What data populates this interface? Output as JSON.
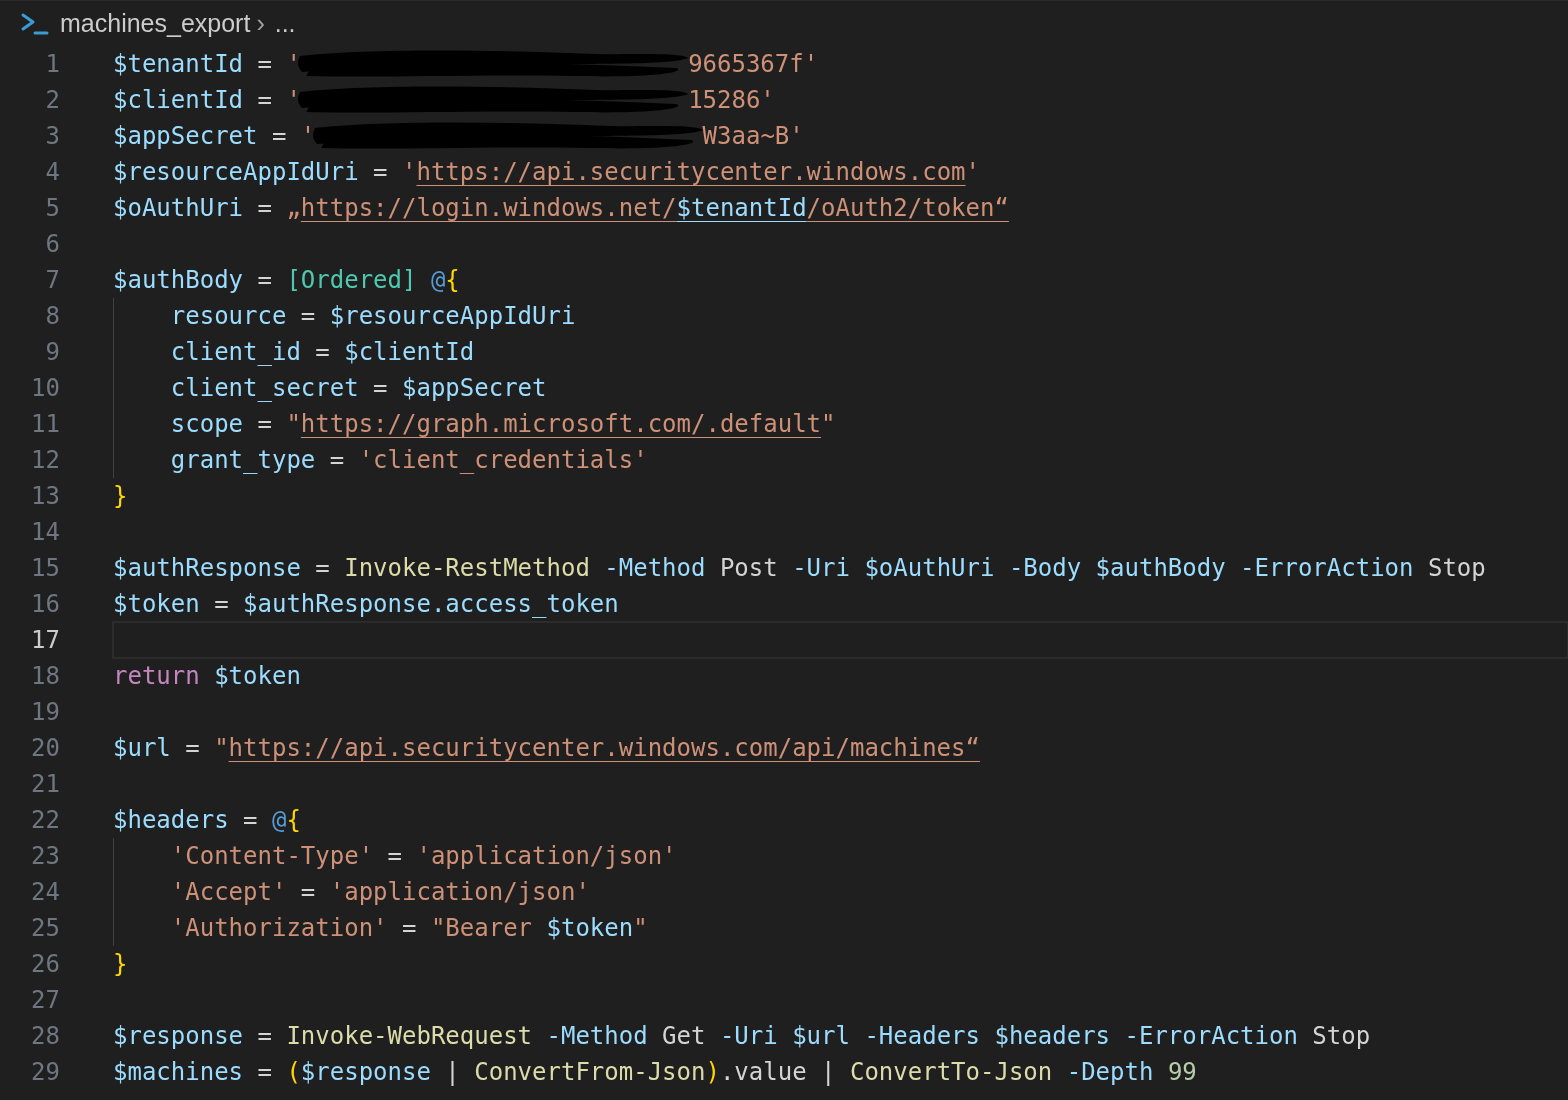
{
  "breadcrumb": {
    "file": "machines_export",
    "separator": "›",
    "more": "..."
  },
  "lines": [
    {
      "number": "1",
      "current": false,
      "tokens": [
        {
          "kind": "variable",
          "text": "$tenantId"
        },
        {
          "kind": "operator",
          "text": " = "
        },
        {
          "kind": "string",
          "text": "'"
        },
        {
          "kind": "redaction"
        },
        {
          "kind": "string",
          "text": "9665367f'"
        }
      ]
    },
    {
      "number": "2",
      "current": false,
      "tokens": [
        {
          "kind": "variable",
          "text": "$clientId"
        },
        {
          "kind": "operator",
          "text": " = "
        },
        {
          "kind": "string",
          "text": "'"
        },
        {
          "kind": "redaction"
        },
        {
          "kind": "string",
          "text": "15286'"
        }
      ]
    },
    {
      "number": "3",
      "current": false,
      "tokens": [
        {
          "kind": "variable",
          "text": "$appSecret"
        },
        {
          "kind": "operator",
          "text": " = "
        },
        {
          "kind": "string",
          "text": "'"
        },
        {
          "kind": "redaction"
        },
        {
          "kind": "string",
          "text": "W3aa~B'"
        }
      ]
    },
    {
      "number": "4",
      "current": false,
      "tokens": [
        {
          "kind": "variable",
          "text": "$resourceAppIdUri"
        },
        {
          "kind": "operator",
          "text": " = "
        },
        {
          "kind": "string",
          "text": "'"
        },
        {
          "kind": "url",
          "text": "https://api.securitycenter.windows.com"
        },
        {
          "kind": "string",
          "text": "'"
        }
      ]
    },
    {
      "number": "5",
      "current": false,
      "tokens": [
        {
          "kind": "variable",
          "text": "$oAuthUri"
        },
        {
          "kind": "operator",
          "text": " = "
        },
        {
          "kind": "string",
          "text": "„"
        },
        {
          "kind": "url",
          "text": "https://login.windows.net/"
        },
        {
          "kind": "url-variable",
          "text": "$tenantId"
        },
        {
          "kind": "url",
          "text": "/oAuth2/token“"
        }
      ]
    },
    {
      "number": "6",
      "current": false
    },
    {
      "number": "7",
      "current": false,
      "tokens": [
        {
          "kind": "variable",
          "text": "$authBody"
        },
        {
          "kind": "operator",
          "text": " = "
        },
        {
          "kind": "type",
          "text": "[Ordered] "
        },
        {
          "kind": "at",
          "text": "@"
        },
        {
          "kind": "brace",
          "text": "{"
        }
      ]
    },
    {
      "number": "8",
      "current": false,
      "tokens": [
        {
          "kind": "indent"
        },
        {
          "kind": "key",
          "text": "resource"
        },
        {
          "kind": "operator",
          "text": " = "
        },
        {
          "kind": "variable",
          "text": "$resourceAppIdUri"
        }
      ]
    },
    {
      "number": "9",
      "current": false,
      "tokens": [
        {
          "kind": "indent"
        },
        {
          "kind": "key",
          "text": "client_id"
        },
        {
          "kind": "operator",
          "text": " = "
        },
        {
          "kind": "variable",
          "text": "$clientId"
        }
      ]
    },
    {
      "number": "10",
      "current": false,
      "tokens": [
        {
          "kind": "indent"
        },
        {
          "kind": "key",
          "text": "client_secret"
        },
        {
          "kind": "operator",
          "text": " = "
        },
        {
          "kind": "variable",
          "text": "$appSecret"
        }
      ]
    },
    {
      "number": "11",
      "current": false,
      "tokens": [
        {
          "kind": "indent"
        },
        {
          "kind": "key",
          "text": "scope"
        },
        {
          "kind": "operator",
          "text": " = "
        },
        {
          "kind": "string",
          "text": "\""
        },
        {
          "kind": "url",
          "text": "https://graph.microsoft.com/.default"
        },
        {
          "kind": "string",
          "text": "\""
        }
      ]
    },
    {
      "number": "12",
      "current": false,
      "tokens": [
        {
          "kind": "indent"
        },
        {
          "kind": "key",
          "text": "grant_type"
        },
        {
          "kind": "operator",
          "text": " = "
        },
        {
          "kind": "string",
          "text": "'client_credentials'"
        }
      ]
    },
    {
      "number": "13",
      "current": false,
      "tokens": [
        {
          "kind": "brace",
          "text": "}"
        }
      ]
    },
    {
      "number": "14",
      "current": false
    },
    {
      "number": "15",
      "current": false,
      "tokens": [
        {
          "kind": "variable",
          "text": "$authResponse"
        },
        {
          "kind": "operator",
          "text": " = "
        },
        {
          "kind": "command",
          "text": "Invoke-RestMethod "
        },
        {
          "kind": "parameter",
          "text": "-Method"
        },
        {
          "kind": "plain",
          "text": " Post "
        },
        {
          "kind": "parameter",
          "text": "-Uri "
        },
        {
          "kind": "variable",
          "text": "$oAuthUri "
        },
        {
          "kind": "parameter",
          "text": "-Body "
        },
        {
          "kind": "variable",
          "text": "$authBody "
        },
        {
          "kind": "parameter",
          "text": "-ErrorAction"
        },
        {
          "kind": "plain",
          "text": " Stop"
        }
      ]
    },
    {
      "number": "16",
      "current": false,
      "tokens": [
        {
          "kind": "variable",
          "text": "$token"
        },
        {
          "kind": "operator",
          "text": " = "
        },
        {
          "kind": "variable",
          "text": "$authResponse.access_token"
        }
      ]
    },
    {
      "number": "17",
      "current": true
    },
    {
      "number": "18",
      "current": false,
      "tokens": [
        {
          "kind": "keyword",
          "text": "return "
        },
        {
          "kind": "variable",
          "text": "$token"
        }
      ]
    },
    {
      "number": "19",
      "current": false
    },
    {
      "number": "20",
      "current": false,
      "tokens": [
        {
          "kind": "variable",
          "text": "$url"
        },
        {
          "kind": "operator",
          "text": " = "
        },
        {
          "kind": "string",
          "text": "\""
        },
        {
          "kind": "url",
          "text": "https://api.securitycenter.windows.com/api/machines“"
        }
      ]
    },
    {
      "number": "21",
      "current": false
    },
    {
      "number": "22",
      "current": false,
      "tokens": [
        {
          "kind": "variable",
          "text": "$headers"
        },
        {
          "kind": "operator",
          "text": " = "
        },
        {
          "kind": "at",
          "text": "@"
        },
        {
          "kind": "brace",
          "text": "{"
        }
      ]
    },
    {
      "number": "23",
      "current": false,
      "tokens": [
        {
          "kind": "indent"
        },
        {
          "kind": "string",
          "text": "'Content-Type'"
        },
        {
          "kind": "operator",
          "text": " = "
        },
        {
          "kind": "string",
          "text": "'application/json'"
        }
      ]
    },
    {
      "number": "24",
      "current": false,
      "tokens": [
        {
          "kind": "indent"
        },
        {
          "kind": "string",
          "text": "'Accept'"
        },
        {
          "kind": "operator",
          "text": " = "
        },
        {
          "kind": "string",
          "text": "'application/json'"
        }
      ]
    },
    {
      "number": "25",
      "current": false,
      "tokens": [
        {
          "kind": "indent"
        },
        {
          "kind": "string",
          "text": "'Authorization'"
        },
        {
          "kind": "operator",
          "text": " = "
        },
        {
          "kind": "string",
          "text": "\"Bearer "
        },
        {
          "kind": "variable",
          "text": "$token"
        },
        {
          "kind": "string",
          "text": "\""
        }
      ]
    },
    {
      "number": "26",
      "current": false,
      "tokens": [
        {
          "kind": "brace",
          "text": "}"
        }
      ]
    },
    {
      "number": "27",
      "current": false
    },
    {
      "number": "28",
      "current": false,
      "tokens": [
        {
          "kind": "variable",
          "text": "$response"
        },
        {
          "kind": "operator",
          "text": " = "
        },
        {
          "kind": "command",
          "text": "Invoke-WebRequest "
        },
        {
          "kind": "parameter",
          "text": "-Method"
        },
        {
          "kind": "plain",
          "text": " Get "
        },
        {
          "kind": "parameter",
          "text": "-Uri "
        },
        {
          "kind": "variable",
          "text": "$url "
        },
        {
          "kind": "parameter",
          "text": "-Headers "
        },
        {
          "kind": "variable",
          "text": "$headers "
        },
        {
          "kind": "parameter",
          "text": "-ErrorAction"
        },
        {
          "kind": "plain",
          "text": " Stop"
        }
      ]
    },
    {
      "number": "29",
      "current": false,
      "tokens": [
        {
          "kind": "variable",
          "text": "$machines"
        },
        {
          "kind": "operator",
          "text": " = "
        },
        {
          "kind": "brace",
          "text": "("
        },
        {
          "kind": "variable",
          "text": "$response"
        },
        {
          "kind": "operator",
          "text": " | "
        },
        {
          "kind": "command",
          "text": "ConvertFrom-Json"
        },
        {
          "kind": "brace",
          "text": ")"
        },
        {
          "kind": "plain",
          "text": ".value"
        },
        {
          "kind": "operator",
          "text": " | "
        },
        {
          "kind": "command",
          "text": "ConvertTo-Json "
        },
        {
          "kind": "parameter",
          "text": "-Depth "
        },
        {
          "kind": "number",
          "text": "99"
        }
      ]
    }
  ]
}
